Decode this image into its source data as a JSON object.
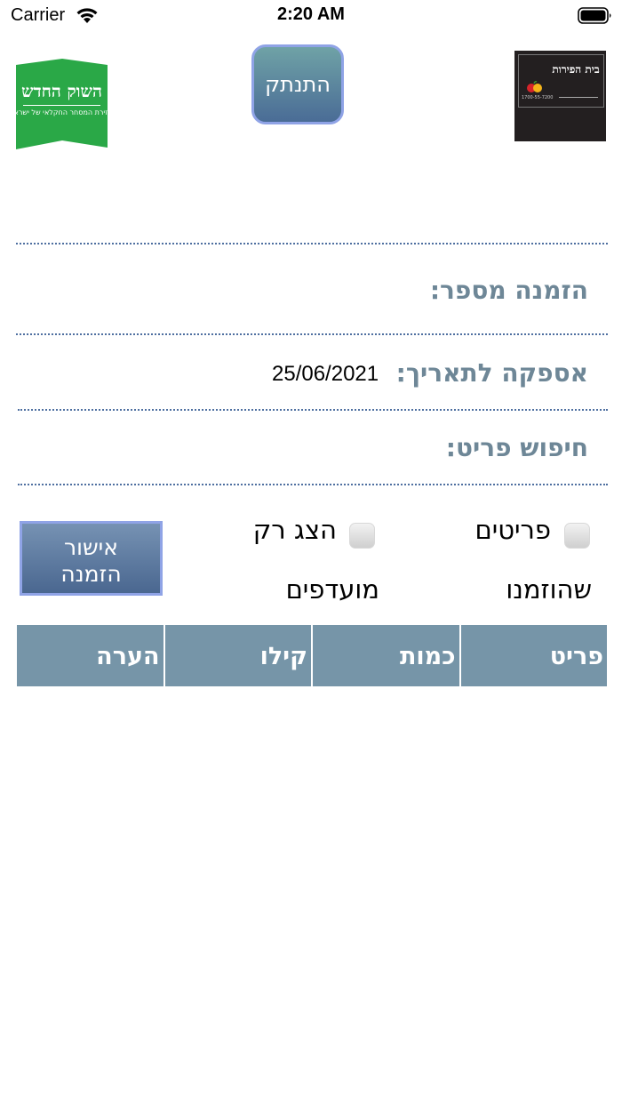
{
  "status_bar": {
    "carrier": "Carrier",
    "time": "2:20 AM"
  },
  "header": {
    "left_logo": {
      "title": "השוק החדש",
      "subtitle": "זירת המסחר החקלאי של ישראל",
      "color": "#2aa847"
    },
    "right_logo": {
      "title": "בית הפירות",
      "phone": "1700-55-7200"
    },
    "logout_label": "התנתק"
  },
  "form": {
    "order_number_label": "הזמנה מספר:",
    "delivery_date_label": "אספקה לתאריך:",
    "delivery_date_value": "25/06/2021",
    "item_search_label": "חיפוש פריט:"
  },
  "filters": {
    "ordered_items": {
      "label_line1": "פריטים",
      "label_line2": "שהוזמנו",
      "checked": false
    },
    "show_favorites": {
      "label_line1": "הצג רק",
      "label_line2": "מועדפים",
      "checked": false
    },
    "confirm_label_line1": "אישור",
    "confirm_label_line2": "הזמנה"
  },
  "table": {
    "columns": [
      "פריט",
      "כמות",
      "קילו",
      "הערה"
    ]
  },
  "colors": {
    "accent": "#7695a8",
    "label": "#6e8797",
    "divider": "#4e6fa0",
    "button_border": "#8fa3e6"
  }
}
